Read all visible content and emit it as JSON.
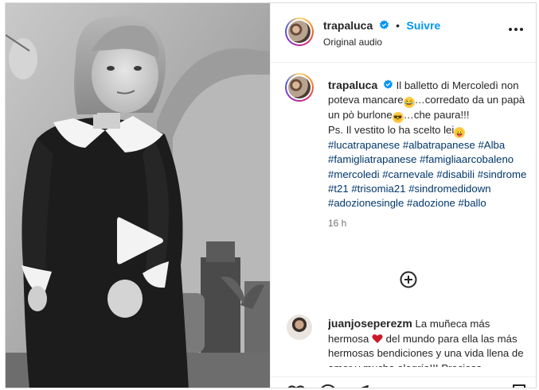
{
  "post": {
    "username": "trapaluca",
    "follow_label": "Suivre",
    "separator": "•",
    "audio_label": "Original audio"
  },
  "caption": {
    "username": "trapaluca",
    "line1": "Il balletto di Mercoledì non poteva mancare",
    "line2": "…corredato da un papà un pò burlone",
    "line3": "…che paura!!!",
    "line4": "Ps. Il vestito lo ha scelto lei",
    "hashtags": [
      "#lucatrapanese",
      "#albatrapanese",
      "#Alba",
      "#famigliatrapanese",
      "#famigliaarcobaleno",
      "#mercoledi",
      "#carnevale",
      "#disabili",
      "#sindrome",
      "#t21",
      "#trisomia21",
      "#sindromedidown",
      "#adozionesingle",
      "#adozione",
      "#ballo"
    ],
    "timestamp": "16 h"
  },
  "comment": {
    "username": "juanjoseperezm",
    "text_before_heart": "La muñeca más hermosa",
    "text_after_heart": "del mundo para ella las más hermosas bendiciones y una vida llena de amor y mucha alegría!!! Preciosa"
  },
  "icons": {
    "verified": "verified-badge-icon",
    "more": "more-options-icon",
    "play": "play-icon",
    "add_comment": "add-comment-icon",
    "like": "heart-icon",
    "comment": "comment-icon",
    "share": "share-icon",
    "save": "bookmark-icon"
  },
  "colors": {
    "link_blue": "#0095f6",
    "hashtag": "#00376b",
    "text": "#262626",
    "muted": "#737373",
    "heart_red": "#c91b2a"
  }
}
